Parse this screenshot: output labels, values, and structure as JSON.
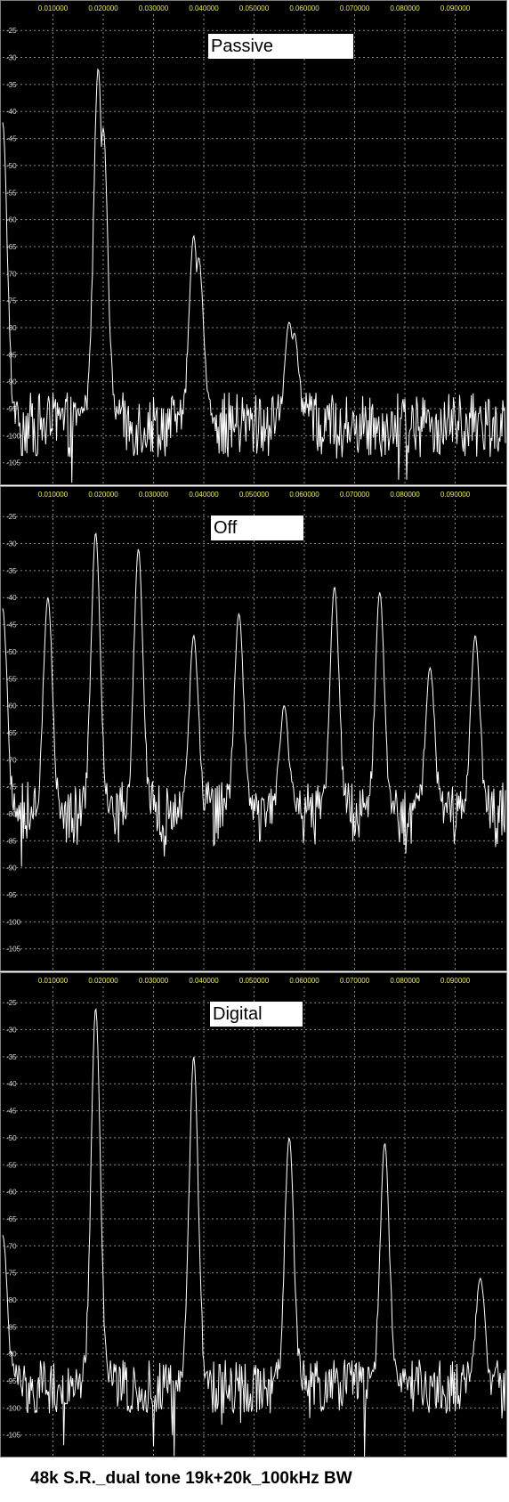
{
  "caption": "48k S.R._dual tone 19k+20k_100kHz BW",
  "colors": {
    "background": "#000000",
    "trace": "#ffffff",
    "grid": "#8a8a8a",
    "x_tick_text": "#e8e86a",
    "y_tick_text": "#d8d8d8",
    "label_box": "#ffffff"
  },
  "panels": [
    {
      "label": "Passive"
    },
    {
      "label": "Off"
    },
    {
      "label": "Digital"
    }
  ],
  "chart_data": [
    {
      "type": "line",
      "title": "Passive",
      "xlabel": "",
      "ylabel": "",
      "x_ticks": [
        "0.010000",
        "0.020000",
        "0.030000",
        "0.040000",
        "0.050000",
        "0.060000",
        "0.070000",
        "0.080000",
        "0.090000"
      ],
      "y_ticks": [
        "-25",
        "-30",
        "-35",
        "-40",
        "-45",
        "-50",
        "-55",
        "-60",
        "-65",
        "-70",
        "-75",
        "-80",
        "-85",
        "-90",
        "-95",
        "-100",
        "-105"
      ],
      "xlim": [
        0.0,
        0.1
      ],
      "ylim": [
        -109,
        -22
      ],
      "grid": true,
      "noise_floor": -98,
      "noise_amplitude": 6,
      "peaks": [
        {
          "x": 0.0,
          "y": -42
        },
        {
          "x": 0.0185,
          "y": -77
        },
        {
          "x": 0.019,
          "y": -32
        },
        {
          "x": 0.02,
          "y": -43
        },
        {
          "x": 0.038,
          "y": -63
        },
        {
          "x": 0.039,
          "y": -67
        },
        {
          "x": 0.057,
          "y": -79
        },
        {
          "x": 0.058,
          "y": -81
        }
      ]
    },
    {
      "type": "line",
      "title": "Off",
      "xlabel": "",
      "ylabel": "",
      "x_ticks": [
        "0.010000",
        "0.020000",
        "0.030000",
        "0.040000",
        "0.050000",
        "0.060000",
        "0.070000",
        "0.080000",
        "0.090000"
      ],
      "y_ticks": [
        "-25",
        "-30",
        "-35",
        "-40",
        "-45",
        "-50",
        "-55",
        "-60",
        "-65",
        "-70",
        "-75",
        "-80",
        "-85",
        "-90",
        "-95",
        "-100",
        "-105"
      ],
      "xlim": [
        0.0,
        0.1
      ],
      "ylim": [
        -109,
        -22
      ],
      "grid": true,
      "noise_floor": -80,
      "noise_amplitude": 6,
      "peaks": [
        {
          "x": 0.0,
          "y": -42
        },
        {
          "x": 0.009,
          "y": -40
        },
        {
          "x": 0.0185,
          "y": -28
        },
        {
          "x": 0.027,
          "y": -31
        },
        {
          "x": 0.038,
          "y": -47
        },
        {
          "x": 0.047,
          "y": -43
        },
        {
          "x": 0.056,
          "y": -60
        },
        {
          "x": 0.066,
          "y": -38
        },
        {
          "x": 0.075,
          "y": -39
        },
        {
          "x": 0.085,
          "y": -53
        },
        {
          "x": 0.094,
          "y": -47
        }
      ]
    },
    {
      "type": "line",
      "title": "Digital",
      "xlabel": "",
      "ylabel": "",
      "x_ticks": [
        "0.010000",
        "0.020000",
        "0.030000",
        "0.040000",
        "0.050000",
        "0.060000",
        "0.070000",
        "0.080000",
        "0.090000"
      ],
      "y_ticks": [
        "-25",
        "-30",
        "-35",
        "-40",
        "-45",
        "-50",
        "-55",
        "-60",
        "-65",
        "-70",
        "-75",
        "-80",
        "-85",
        "-90",
        "-95",
        "-100",
        "-105"
      ],
      "xlim": [
        0.0,
        0.1
      ],
      "ylim": [
        -109,
        -22
      ],
      "grid": true,
      "noise_floor": -96,
      "noise_amplitude": 5,
      "peaks": [
        {
          "x": 0.0,
          "y": -68
        },
        {
          "x": 0.0185,
          "y": -26
        },
        {
          "x": 0.038,
          "y": -35
        },
        {
          "x": 0.057,
          "y": -50
        },
        {
          "x": 0.076,
          "y": -51
        },
        {
          "x": 0.095,
          "y": -76
        }
      ]
    }
  ]
}
